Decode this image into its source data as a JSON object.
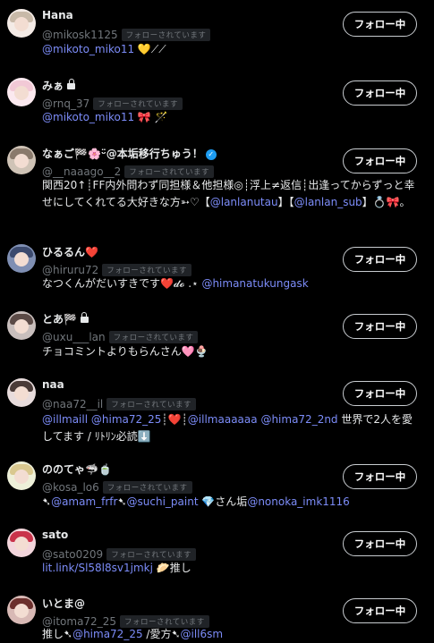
{
  "follow_button_label": "フォロー中",
  "follows_you_badge": "フォローされています",
  "users": [
    {
      "name": "Hana",
      "handle": "@mikosk1125",
      "lock": false,
      "verified": false,
      "bio": [
        {
          "t": "@mikoto_miko11",
          "m": true
        },
        {
          "t": " 💛⟋⟋",
          "m": false
        }
      ],
      "hair": "#c8b9a8",
      "bg": "#f4ebe6"
    },
    {
      "name": "みぁ",
      "handle": "@rnq_37",
      "lock": true,
      "verified": false,
      "bio": [
        {
          "t": "@mikoto_miko11",
          "m": true
        },
        {
          "t": " 🎀 🪄",
          "m": false
        }
      ],
      "hair": "#f2c9d6",
      "bg": "#fbe9ef"
    },
    {
      "name": "なぁご🏁🌸ᵕ̈@本垢移行ちゅう！",
      "handle": "@__naaago__2",
      "lock": false,
      "verified": true,
      "bio": [
        {
          "t": "関西20↑┊FF内外問わず同担様＆他担様◎┊浮上≠返信┊出逢ってからずっと幸せにしてくれてる大好きな方➳♡【",
          "m": false
        },
        {
          "t": "@lanlanutau",
          "m": true
        },
        {
          "t": "】【",
          "m": false
        },
        {
          "t": "@lanlan_sub",
          "m": true
        },
        {
          "t": "】💍🎀。",
          "m": false
        }
      ],
      "hair": "#8a7a6c",
      "bg": "#cfc3b6"
    },
    {
      "name": "ひるるん❤️",
      "handle": "@hiruru72",
      "lock": false,
      "verified": false,
      "bio": [
        {
          "t": "なつくんがだいすきです❤️𝓭𝓸 .⋆ ",
          "m": false
        },
        {
          "t": "@himanatukungask",
          "m": true
        }
      ],
      "hair": "#3c4a6e",
      "bg": "#7f8fb3"
    },
    {
      "name": "とあ🏁",
      "handle": "@uxu___lan",
      "lock": true,
      "verified": false,
      "bio": [
        {
          "t": "チョコミントよりもらんさん🩷🍨",
          "m": false
        }
      ],
      "hair": "#5b4a46",
      "bg": "#c9bfbd"
    },
    {
      "name": "naa",
      "handle": "@naa72__il",
      "lock": false,
      "verified": false,
      "bio": [
        {
          "t": "@illmaill",
          "m": true
        },
        {
          "t": " ",
          "m": false
        },
        {
          "t": "@hima72_25",
          "m": true
        },
        {
          "t": "┊❤️┊",
          "m": false
        },
        {
          "t": "@illmaaaaaa",
          "m": true
        },
        {
          "t": " ",
          "m": false
        },
        {
          "t": "@hima72_2nd",
          "m": true
        },
        {
          "t": " 世界で2人を愛してます / ﾘﾄﾘﾝ必読⬇️",
          "m": false
        }
      ],
      "hair": "#4a3b38",
      "bg": "#e8dcdc"
    },
    {
      "name": "ののてゃ🦈🍵",
      "handle": "@kosa_lo6",
      "lock": false,
      "verified": false,
      "bio": [
        {
          "t": "➷",
          "m": false
        },
        {
          "t": "@amam_frfr",
          "m": true
        },
        {
          "t": "➷",
          "m": false
        },
        {
          "t": "@suchi_paint",
          "m": true
        },
        {
          "t": " 💎さん垢",
          "m": false
        },
        {
          "t": "@nonoka_imk1116",
          "m": true
        }
      ],
      "hair": "#d9c88f",
      "bg": "#eef0d9"
    },
    {
      "name": "sato",
      "handle": "@sato0209",
      "lock": false,
      "verified": false,
      "bio": [
        {
          "t": "lit.link/Sl58l8sv1jmkj",
          "m": true
        },
        {
          "t": " 🥟推し",
          "m": false
        }
      ],
      "hair": "#c9334a",
      "bg": "#f3d6dc"
    },
    {
      "name": "いとま@",
      "handle": "@itoma72_25",
      "lock": false,
      "verified": false,
      "bio": [
        {
          "t": "推し➷",
          "m": false
        },
        {
          "t": "@hima72_25",
          "m": true
        },
        {
          "t": " /愛方➷",
          "m": false
        },
        {
          "t": "@ill6sm",
          "m": true
        }
      ],
      "hair": "#6b2f2c",
      "bg": "#d8b9b5"
    }
  ]
}
